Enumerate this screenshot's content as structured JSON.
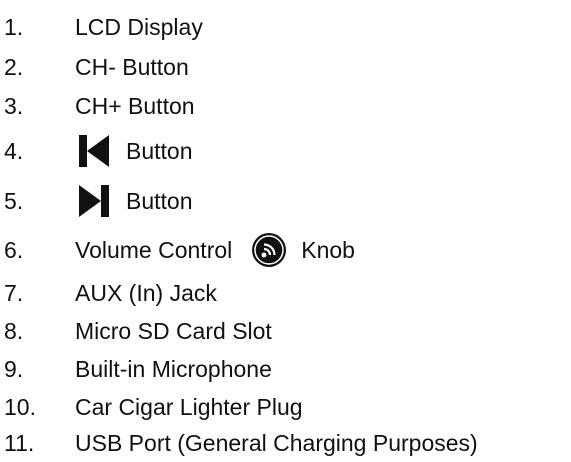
{
  "items": [
    {
      "number": "1.",
      "label": "LCD Display"
    },
    {
      "number": "2.",
      "label": "CH- Button"
    },
    {
      "number": "3.",
      "label": "CH+ Button"
    },
    {
      "number": "4.",
      "label": "Button",
      "icon": "skip-previous-icon"
    },
    {
      "number": "5.",
      "label": "Button",
      "icon": "skip-next-icon"
    },
    {
      "number": "6.",
      "label": "Volume Control",
      "label_after": "Knob",
      "icon": "volume-knob-icon"
    },
    {
      "number": "7.",
      "label": "AUX (In) Jack"
    },
    {
      "number": "8.",
      "label": "Micro SD Card Slot"
    },
    {
      "number": "9.",
      "label": "Built-in Microphone"
    },
    {
      "number": "10.",
      "label": "Car Cigar Lighter Plug"
    },
    {
      "number": "11.",
      "label": "USB Port (General Charging Purposes)"
    }
  ],
  "colors": {
    "text": "#111111",
    "icon": "#111111",
    "background": "#ffffff"
  }
}
